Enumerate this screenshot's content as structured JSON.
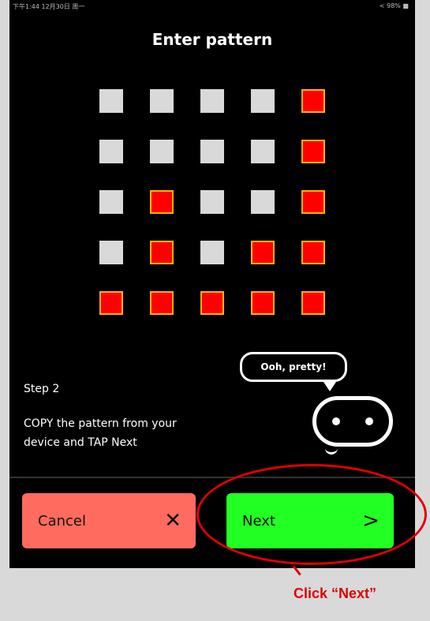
{
  "status_bar": {
    "left_text": "下午1:44 12月30日 周一",
    "right_text": "< 98% ■"
  },
  "page": {
    "title": "Enter pattern"
  },
  "pattern": {
    "rows": [
      [
        0,
        0,
        0,
        0,
        1
      ],
      [
        0,
        0,
        0,
        0,
        1
      ],
      [
        0,
        1,
        0,
        0,
        1
      ],
      [
        0,
        1,
        0,
        1,
        1
      ],
      [
        1,
        1,
        1,
        1,
        1
      ]
    ],
    "colors": {
      "on": "#ff0000",
      "on_border": "#ffb300",
      "off": "#d9d9d9"
    }
  },
  "instructions": {
    "step": "Step 2",
    "line1": "COPY the pattern from your",
    "line2": "device and TAP Next"
  },
  "mascot": {
    "speech": "Ooh, pretty!"
  },
  "buttons": {
    "cancel": {
      "label": "Cancel",
      "icon": "close-icon",
      "color": "#ff6b5e"
    },
    "next": {
      "label": "Next",
      "icon": "chevron-right-icon",
      "color": "#22ff22"
    }
  },
  "annotation": {
    "text": "Click “Next”",
    "color": "#e00000"
  }
}
